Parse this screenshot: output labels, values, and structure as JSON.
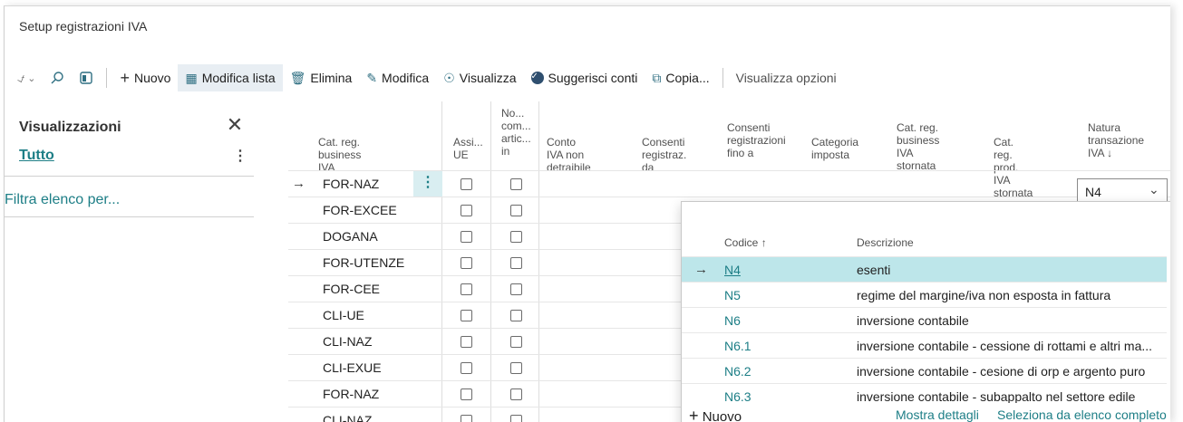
{
  "page": {
    "title": "Setup registrazioni IVA"
  },
  "toolbar": {
    "new_label": "Nuovo",
    "edit_list_label": "Modifica lista",
    "delete_label": "Elimina",
    "edit_label": "Modifica",
    "view_label": "Visualizza",
    "suggest_label": "Suggerisci conti",
    "copy_label": "Copia...",
    "view_options_label": "Visualizza opzioni"
  },
  "left_pane": {
    "heading": "Visualizzazioni",
    "all_label": "Tutto",
    "filter_label": "Filtra elenco per..."
  },
  "columns": {
    "c1": [
      "Cat. reg.",
      "business IVA"
    ],
    "c2": [
      "Assi...",
      "UE"
    ],
    "c3": [
      "No...",
      "com...",
      "artic...",
      "in"
    ],
    "c4": [
      "Conto IVA non",
      "detraibile"
    ],
    "c5": [
      "Consenti",
      "registraz. da"
    ],
    "c6": [
      "Consenti",
      "registrazioni",
      "fino a"
    ],
    "c7": [
      "Categoria",
      "imposta"
    ],
    "c8": [
      "Cat. reg.",
      "business IVA",
      "stornata"
    ],
    "c9": [
      "Cat. reg. prod.",
      "IVA stornata"
    ],
    "c10": [
      "Natura",
      "transazione",
      "IVA ↓"
    ]
  },
  "rows": [
    {
      "code": "FOR-NAZ"
    },
    {
      "code": "FOR-EXCEE"
    },
    {
      "code": "DOGANA"
    },
    {
      "code": "FOR-UTENZE"
    },
    {
      "code": "FOR-CEE"
    },
    {
      "code": "CLI-UE"
    },
    {
      "code": "CLI-NAZ"
    },
    {
      "code": "CLI-EXUE"
    },
    {
      "code": "FOR-NAZ"
    },
    {
      "code": "CLI-NAZ"
    }
  ],
  "combo": {
    "value": "N4"
  },
  "dropdown": {
    "header_code": "Codice ↑",
    "header_desc": "Descrizione",
    "items": [
      {
        "code": "N4",
        "desc": "esenti"
      },
      {
        "code": "N5",
        "desc": "regime del margine/iva non esposta in fattura"
      },
      {
        "code": "N6",
        "desc": "inversione contabile"
      },
      {
        "code": "N6.1",
        "desc": "inversione contabile - cessione di rottami e altri ma..."
      },
      {
        "code": "N6.2",
        "desc": "inversione contabile - cesione di orp e argento puro"
      },
      {
        "code": "N6.3",
        "desc": "inversione contabile - subappalto nel settore edile"
      }
    ],
    "new_label": "Nuovo",
    "details_label": "Mostra dettagli",
    "full_list_label": "Seleziona da elenco completo"
  },
  "colors": {
    "accent": "#1d7e86",
    "selected_row": "#bde6ea"
  }
}
